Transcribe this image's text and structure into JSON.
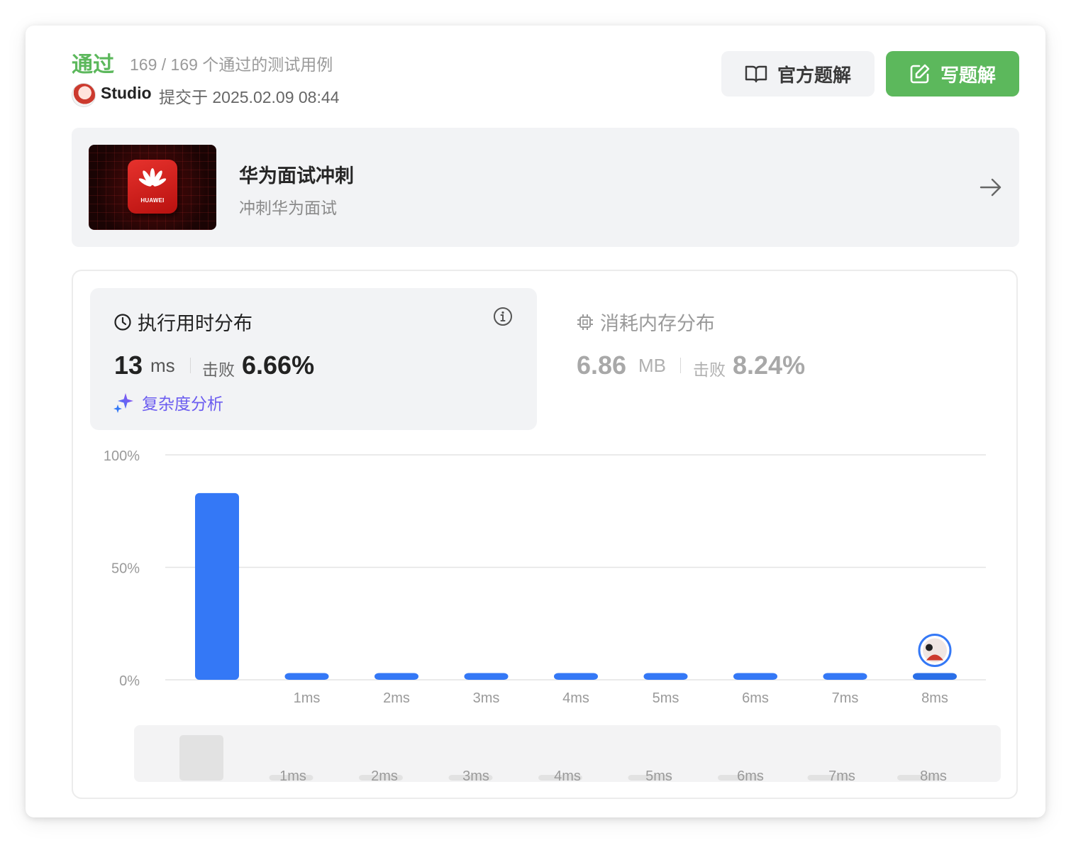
{
  "header": {
    "status": "通过",
    "cases": "169 / 169 个通过的测试用例",
    "username": "Studio",
    "submitted": "提交于 2025.02.09 08:44",
    "official_solution_label": "官方题解",
    "write_solution_label": "写题解"
  },
  "promo": {
    "title": "华为面试冲刺",
    "subtitle": "冲刺华为面试",
    "logo_text": "HUAWEI"
  },
  "runtime": {
    "title": "执行用时分布",
    "value": "13",
    "unit": "ms",
    "beat_label": "击败",
    "beat_value": "6.66%",
    "complexity_label": "复杂度分析"
  },
  "memory": {
    "title": "消耗内存分布",
    "value": "6.86",
    "unit": "MB",
    "beat_label": "击败",
    "beat_value": "8.24%"
  },
  "colors": {
    "accent_green": "#5cb85c",
    "bar_blue": "#3478f6",
    "complexity_purple": "#6b5cf0"
  },
  "chart_data": {
    "type": "bar",
    "categories": [
      "",
      "1ms",
      "2ms",
      "3ms",
      "4ms",
      "5ms",
      "6ms",
      "7ms",
      "8ms"
    ],
    "values": [
      83,
      3,
      3,
      3,
      3,
      3,
      3,
      3,
      3
    ],
    "ylim": [
      0,
      100
    ],
    "yticks": [
      "0%",
      "50%",
      "100%"
    ],
    "user_position": "8ms",
    "grid": true,
    "mini_categories": [
      "1ms",
      "2ms",
      "3ms",
      "4ms",
      "5ms",
      "6ms",
      "7ms",
      "8ms"
    ]
  }
}
